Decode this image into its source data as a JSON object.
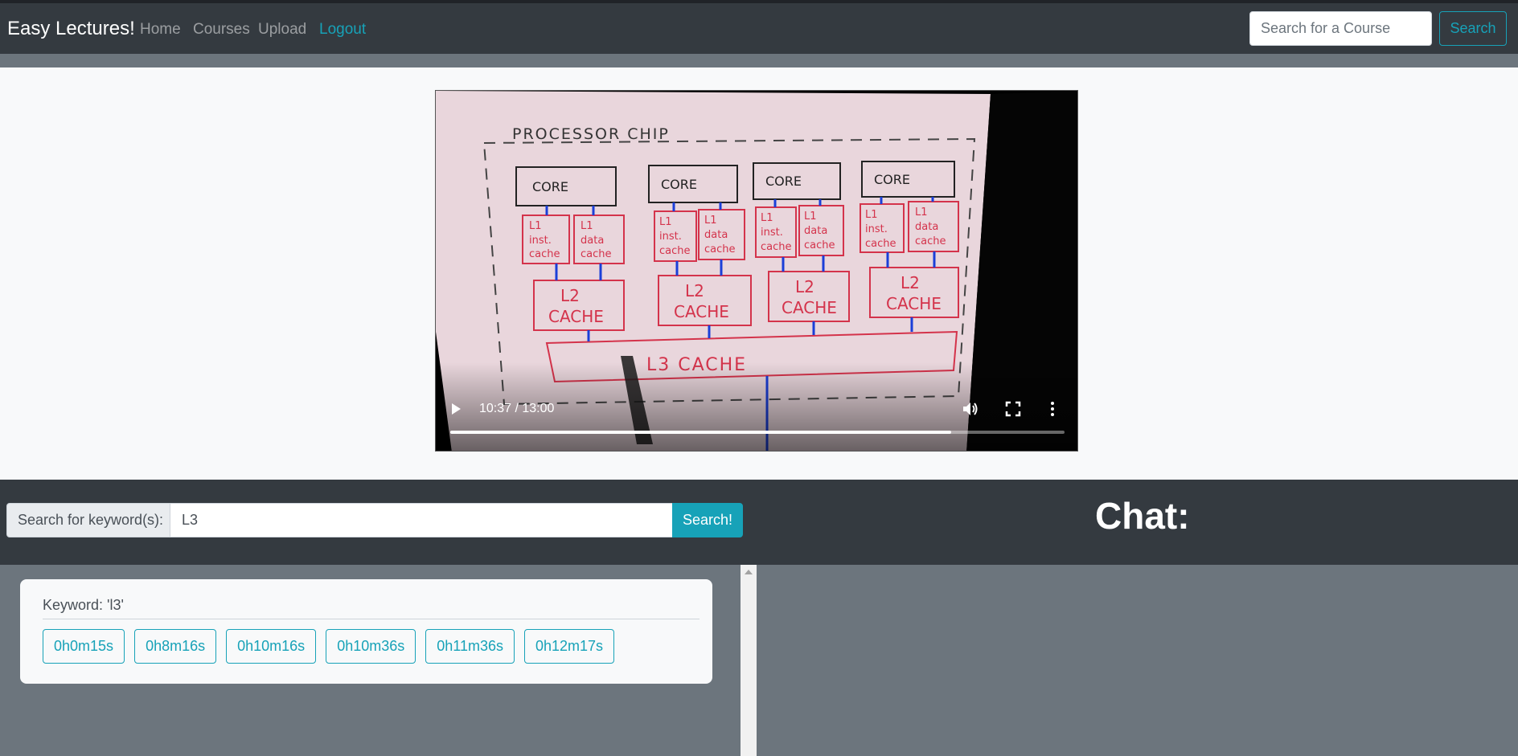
{
  "navbar": {
    "brand": "Easy Lectures!",
    "links": [
      {
        "label": "Home"
      },
      {
        "label": "Courses"
      },
      {
        "label": "Upload"
      },
      {
        "label": "Logout"
      }
    ],
    "search_placeholder": "Search for a Course",
    "search_button": "Search"
  },
  "video": {
    "current_time": "10:37",
    "duration": "13:00",
    "time_display": "10:37 / 13:00",
    "progress_fraction": 0.815,
    "frame": {
      "title": "PROCESSOR CHIP",
      "core_label": "CORE",
      "l1_inst_lines": [
        "L1",
        "inst.",
        "cache"
      ],
      "l1_data_lines": [
        "L1",
        "data",
        "cache"
      ],
      "l2_lines": [
        "L2",
        "CACHE"
      ],
      "l3_label": "L3 CACHE"
    }
  },
  "keyword_search": {
    "label": "Search for keyword(s):",
    "value": "L3",
    "button": "Search!"
  },
  "chat": {
    "title": "Chat:"
  },
  "results": {
    "keyword_title": "Keyword: 'l3'",
    "timestamps": [
      "0h0m15s",
      "0h8m16s",
      "0h10m16s",
      "0h10m36s",
      "0h11m36s",
      "0h12m17s"
    ]
  },
  "colors": {
    "navbar_bg": "#343a40",
    "accent": "#17a2b8",
    "page_bg": "#6c757d",
    "panel_bg": "#f8f9fa"
  }
}
